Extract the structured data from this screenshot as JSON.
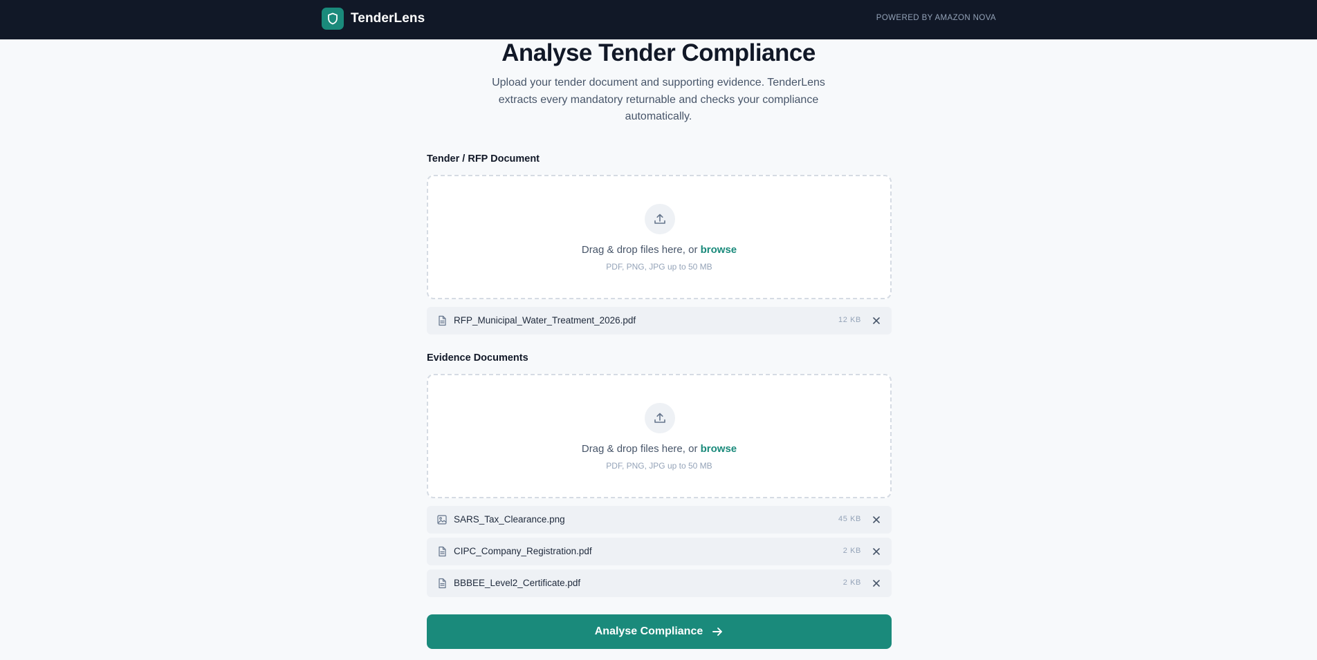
{
  "header": {
    "app_name": "TenderLens",
    "logo_icon": "shield-icon",
    "powered_by": "POWERED BY AMAZON NOVA",
    "background": "#111827",
    "accent": "#1a8a7b"
  },
  "main": {
    "title": "Analyse Tender Compliance",
    "subtitle": "Upload your tender document and supporting evidence. TenderLens extracts every mandatory returnable and checks your compliance automatically."
  },
  "tender_section": {
    "label": "Tender / RFP Document",
    "dropzone": {
      "icon": "upload-icon",
      "text": "Drag & drop files here, or ",
      "link": "browse",
      "hint": "PDF, PNG, JPG up to 50 MB"
    },
    "files": [
      {
        "name": "RFP_Municipal_Water_Treatment_2026.pdf",
        "size": "12 KB",
        "icon": "document-icon"
      }
    ]
  },
  "evidence_section": {
    "label": "Evidence Documents",
    "dropzone": {
      "icon": "upload-icon",
      "text": "Drag & drop files here, or ",
      "link": "browse",
      "hint": "PDF, PNG, JPG up to 50 MB"
    },
    "files": [
      {
        "name": "SARS_Tax_Clearance.png",
        "size": "45 KB",
        "icon": "image-file-icon"
      },
      {
        "name": "CIPC_Company_Registration.pdf",
        "size": "2 KB",
        "icon": "document-icon"
      },
      {
        "name": "BBBEE_Level2_Certificate.pdf",
        "size": "2 KB",
        "icon": "document-icon"
      }
    ]
  },
  "cta": {
    "label": "Analyse Compliance",
    "icon": "arrow-right-icon"
  }
}
